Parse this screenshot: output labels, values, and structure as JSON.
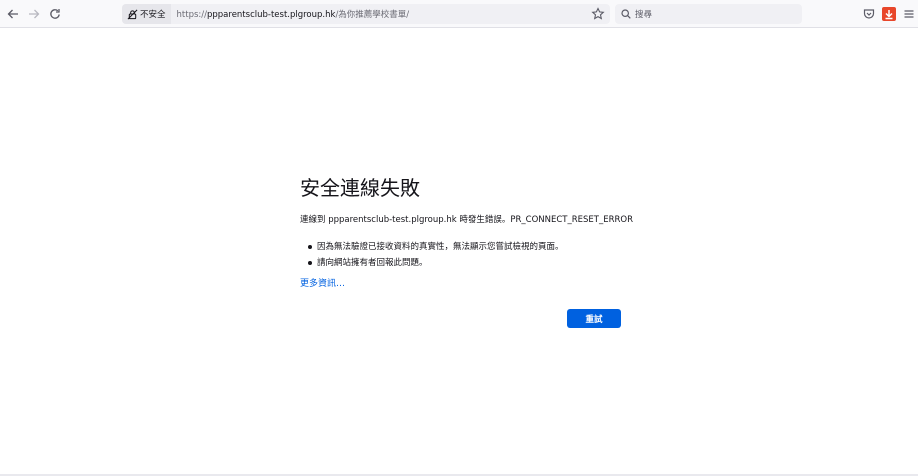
{
  "toolbar": {
    "lock_label": "不安全",
    "url_prefix": "https://",
    "url_host": "ppparentsclub-test.plgroup.hk",
    "url_path": "/為你推薦學校書單/",
    "search_placeholder": "搜尋"
  },
  "error": {
    "title": "安全連線失敗",
    "description": "連線到 ppparentsclub-test.plgroup.hk 時發生錯誤。PR_CONNECT_RESET_ERROR",
    "items": [
      "因為無法驗證已接收資料的真實性，無法顯示您嘗試檢視的頁面。",
      "請向網站擁有者回報此問題。"
    ],
    "more_info": "更多資訊…",
    "retry_label": "重試"
  },
  "colors": {
    "accent": "#0061e0",
    "download_badge": "#e8462a"
  }
}
